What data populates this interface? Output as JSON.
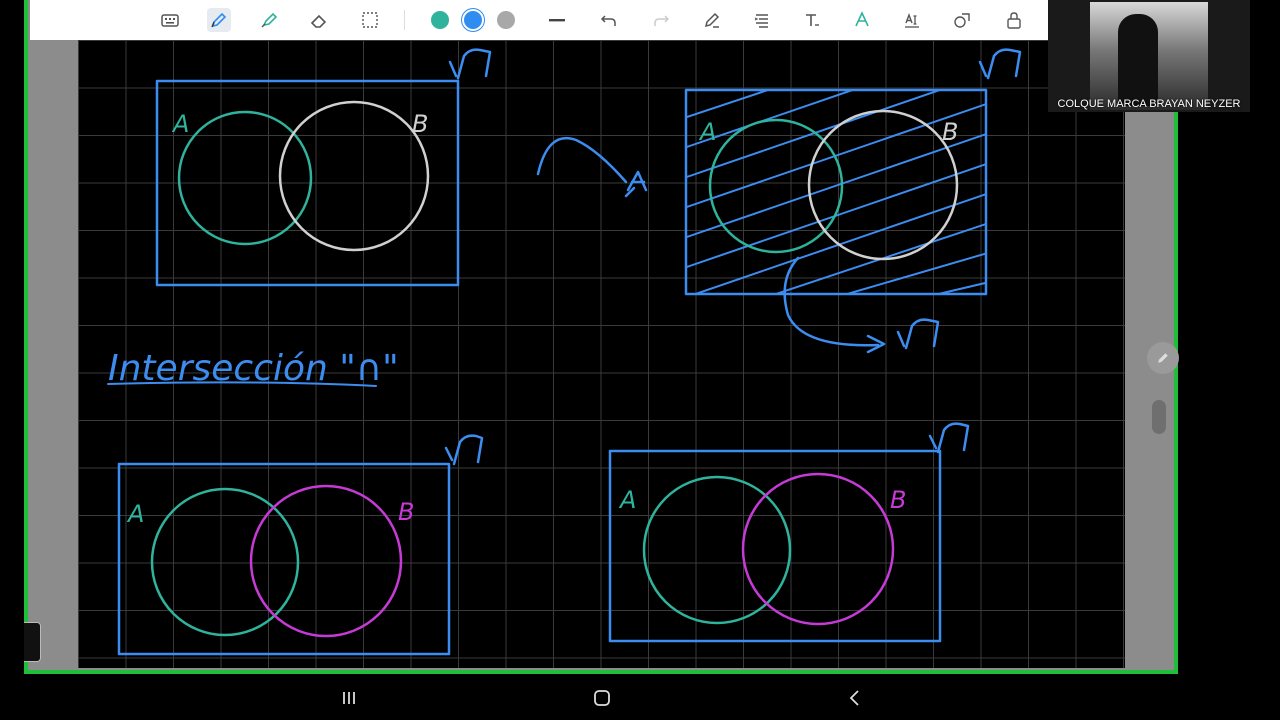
{
  "toolbar": {
    "tools": [
      "keyboard-icon",
      "pen-icon",
      "highlighter-icon",
      "eraser-icon",
      "lasso-select-icon"
    ],
    "colors": [
      "#2fb39c",
      "#2f8cf0",
      "#a8a8a8"
    ],
    "tools_right": [
      "line-width-icon",
      "undo-icon",
      "redo-icon",
      "pen-settings-icon",
      "text-align-icon",
      "text-icon",
      "handwriting-text-icon",
      "text-recognize-icon",
      "shapes-icon",
      "lock-icon"
    ]
  },
  "video": {
    "participant_name": "COLQUE MARCA BRAYAN NEYZER"
  },
  "canvas": {
    "title_text": "Intersección \"∩\"",
    "label_a": "A",
    "label_b": "B",
    "label_u": "U",
    "ink_colors": {
      "blue": "#3d8df0",
      "teal": "#2fb39c",
      "white": "#d0d0d0",
      "magenta": "#c63ad6"
    }
  },
  "navbar": {
    "items": [
      "recent-apps-icon",
      "home-icon",
      "back-icon"
    ]
  }
}
